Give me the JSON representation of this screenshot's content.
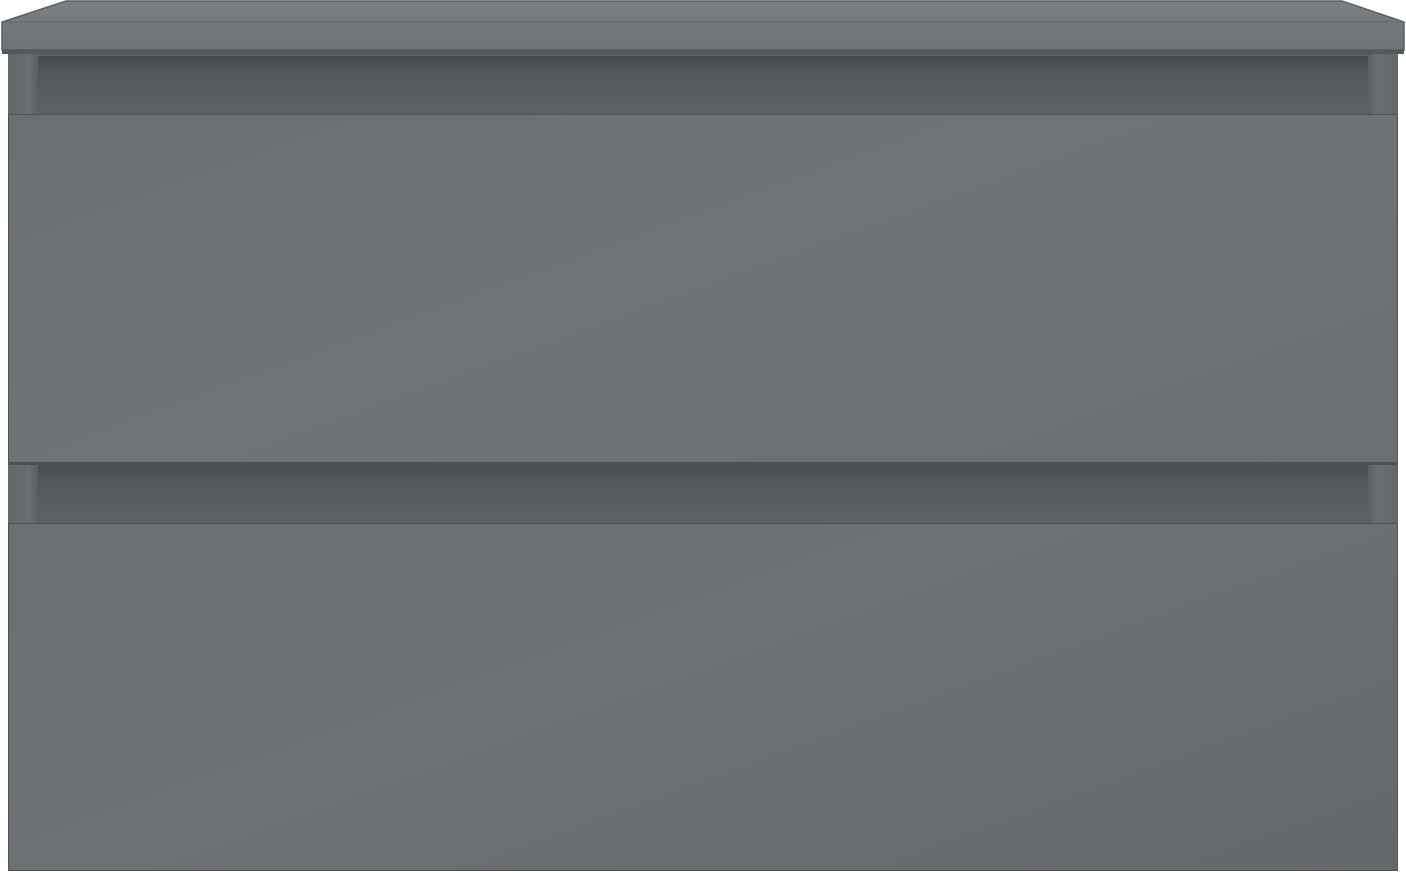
{
  "product": {
    "type": "vanity-cabinet",
    "drawer_count": 2,
    "colors": {
      "top": "#70767a",
      "top_edge": "#5f6467",
      "body": "#5c6164",
      "drawer_front": "#6c7174",
      "recess_shadow": "#44494c",
      "background": "#ffffff"
    }
  }
}
